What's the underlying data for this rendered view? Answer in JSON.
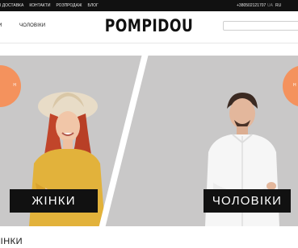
{
  "topbar": {
    "nav": [
      "І ДОСТАВКА",
      "КОНТАКТИ",
      "РОЗПРОДАЖ",
      "БЛОГ"
    ],
    "phone": "+380502121707",
    "lang": [
      "UA",
      "RU"
    ]
  },
  "header": {
    "menu_left": "И",
    "menu_men": "ЧОЛОВІКИ",
    "logo": "POMPIDOU",
    "search_placeholder": ""
  },
  "banner": {
    "women_label": "ЖІНКИ",
    "men_label": "ЧОЛОВІКИ",
    "badge_left_text": "Н",
    "badge_right_text": "Н",
    "badge_color": "#f4925d"
  },
  "section": {
    "title": "ЖІНКИ"
  }
}
